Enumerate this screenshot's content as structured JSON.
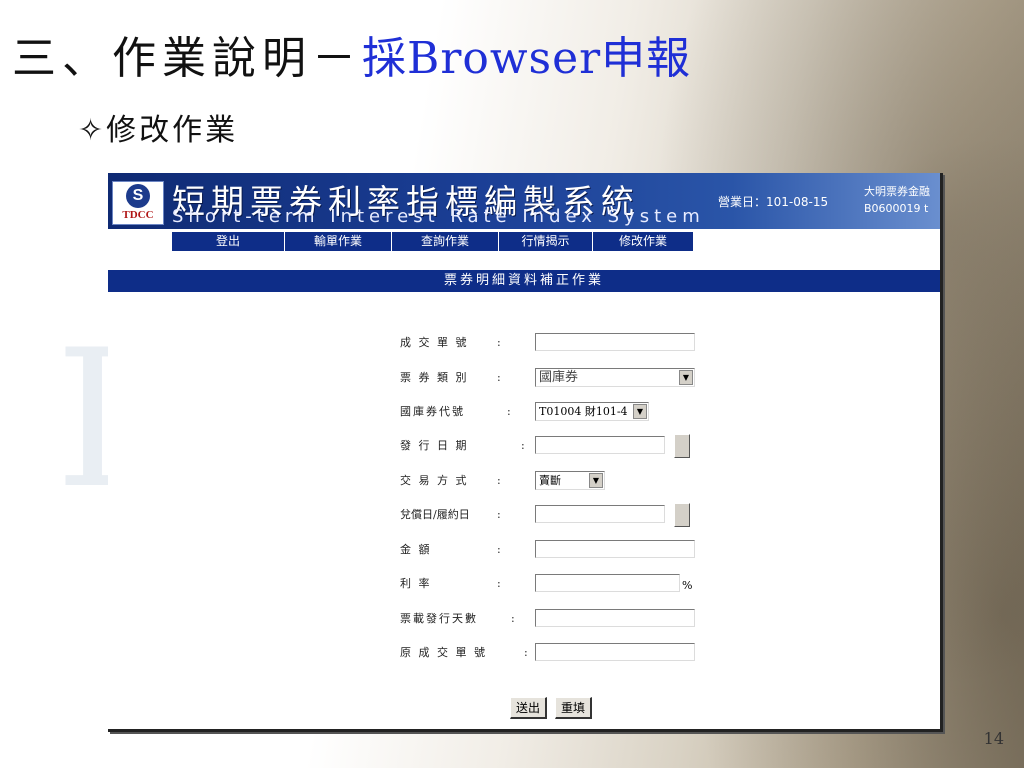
{
  "slide": {
    "title_black": "三、作業說明－",
    "title_blue": "採Browser申報",
    "subtitle": "✧修改作業",
    "page_number": "14",
    "bg_letter": "I",
    "accent_color": "#1f2fd6"
  },
  "app": {
    "logo_text": "TDCC",
    "logo_icon": "tdcc-logo-icon",
    "title_cn": "短期票券利率指標編製系統",
    "title_en": "Short-term Interest Rate Index System",
    "business_date_label": "營業日：",
    "business_date": "101-08-15",
    "user_line1": "大明票券金融",
    "user_line2": "B0600019 t",
    "brand_color": "#0e2d88"
  },
  "nav": {
    "items": [
      {
        "label": "登出"
      },
      {
        "label": "輸單作業"
      },
      {
        "label": "查詢作業"
      },
      {
        "label": "行情揭示"
      },
      {
        "label": "修改作業"
      }
    ]
  },
  "form": {
    "header": "票券明細資料補正作業",
    "fields": [
      {
        "label": "成 交 單 號",
        "value": ""
      },
      {
        "label": "票 券 類 別",
        "value": "國庫券"
      },
      {
        "label": "國庫券代號",
        "value": "T01004 財101-4"
      },
      {
        "label": "發  行  日  期",
        "value": ""
      },
      {
        "label": "交 易 方 式",
        "value": "賣斷"
      },
      {
        "label": "兌償日/履約日",
        "value": ""
      },
      {
        "label": "金       額",
        "value": ""
      },
      {
        "label": "利       率",
        "value": "",
        "suffix": "%"
      },
      {
        "label": "票載發行天數",
        "value": ""
      },
      {
        "label": "原 成 交 單 號",
        "value": ""
      }
    ],
    "colon": ":",
    "submit_label": "送出",
    "reset_label": "重填"
  }
}
